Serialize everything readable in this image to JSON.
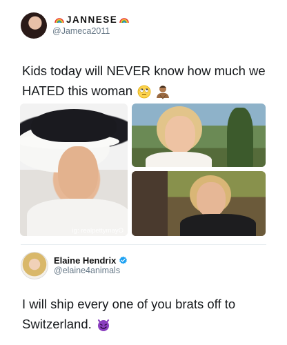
{
  "first_tweet": {
    "display_name": "JANNESE",
    "handle": "@Jameca2011",
    "text": "Kids today will NEVER know how much we HATED this woman",
    "emojis": [
      "face-with-rolling-eyes",
      "man-shrugging"
    ],
    "watermark": "ig: realpettymayO"
  },
  "second_tweet": {
    "display_name": "Elaine Hendrix",
    "handle": "@elaine4animals",
    "text": "I will ship every one of you brats off to Switzerland.",
    "emoji": "smiling-face-with-horns",
    "verified": true
  },
  "colors": {
    "text": "#14171a",
    "handle": "#657786",
    "verified": "#1da1f2",
    "devil_emoji": "#8a3fbf"
  }
}
